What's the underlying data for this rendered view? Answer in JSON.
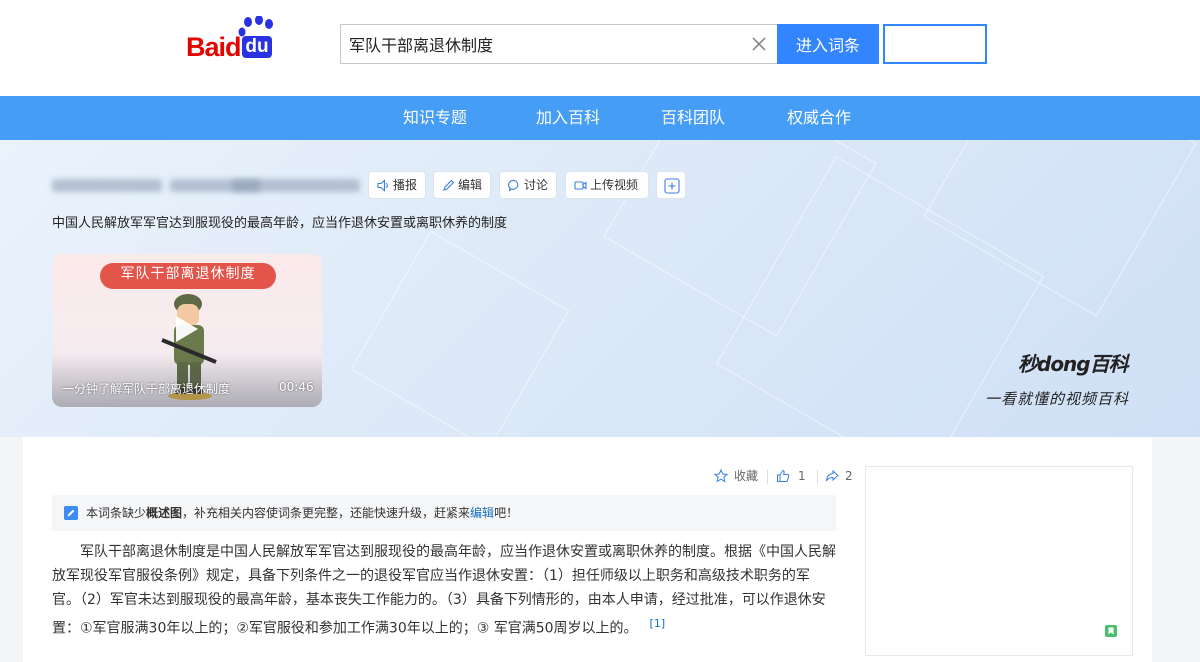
{
  "header": {
    "logo_text": "Baidu",
    "logo_du": "du",
    "search": {
      "value": "军队干部离退休制度",
      "placeholder": ""
    },
    "enter_button": "进入词条",
    "colors": {
      "brand_red": "#e10601",
      "brand_blue": "#2932e1",
      "accent": "#3385ff"
    }
  },
  "nav": {
    "items": [
      "知识专题",
      "加入百科",
      "百科团队",
      "权威合作"
    ],
    "bg": "#459df5"
  },
  "banner": {
    "tools": [
      {
        "icon": "speaker-icon",
        "label": "播报"
      },
      {
        "icon": "edit-icon",
        "label": "编辑"
      },
      {
        "icon": "comment-icon",
        "label": "讨论"
      },
      {
        "icon": "video-upload-icon",
        "label": "上传视频"
      }
    ],
    "summary": "中国人民解放军军官达到服现役的最高年龄，应当作退休安置或离职休养的制度",
    "video": {
      "banner_title": "军队干部离退休制度",
      "caption": "一分钟了解军队干部离退休制度",
      "duration": "00:46"
    },
    "miaodong": {
      "logo": "秒dong百科",
      "tagline": "一看就懂的视频百科"
    }
  },
  "actions": {
    "favorite": "收藏",
    "like_count": "1",
    "share_count": "2"
  },
  "notice": {
    "prefix": "本词条缺少",
    "bold": "概述图",
    "middle": "，补充相关内容使词条更完整，还能快速升级，赶紧来",
    "link": "编辑",
    "suffix": "吧！"
  },
  "paragraph": {
    "lines": [
      "　　军队干部离退休制度是中国人民解放军军官达到服现役的最高年龄，应当作退休安置或离职休养的制度。根据《中国人民解",
      "放军现役军官服役条例》规定，具备下列条件之一的退役军官应当作退休安置：（1）担任师级以上职务和高级技术职务的军",
      "官。（2）军官未达到服现役的最高年龄，基本丧失工作能力的。（3）具备下列情形的，由本人申请，经过批准，可以作退休安",
      "置：①军官服满30年以上的；②军官服役和参加工作满30年以上的；③ 军官满50周岁以上的。"
    ],
    "citation": "[1]"
  }
}
